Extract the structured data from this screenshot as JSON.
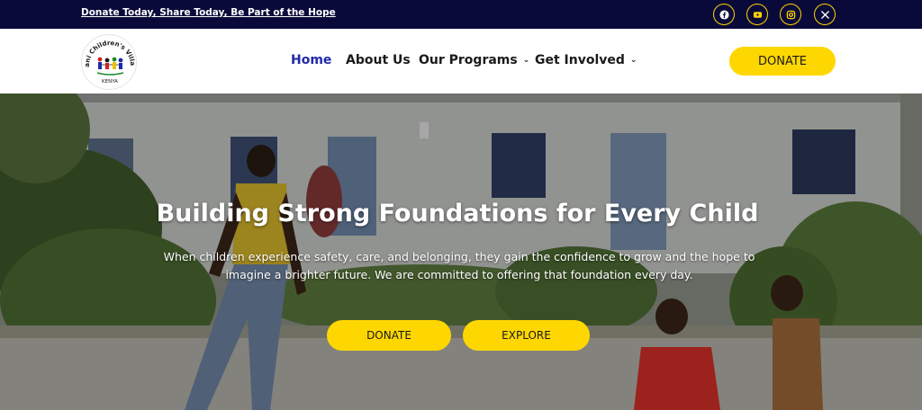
{
  "topbar": {
    "promo_text": "Donate Today, Share Today, Be Part of the Hope",
    "social": [
      {
        "icon": "facebook-icon"
      },
      {
        "icon": "youtube-icon"
      },
      {
        "icon": "instagram-icon"
      },
      {
        "icon": "x-icon"
      }
    ]
  },
  "logo": {
    "text_top": "Diani Children's Village",
    "text_bottom": "KENYA"
  },
  "nav": {
    "home": "Home",
    "about": "About Us",
    "programs": "Our Programs",
    "involved": "Get Involved",
    "caret": "⌄",
    "donate": "DONATE"
  },
  "hero": {
    "title": "Building Strong Foundations for Every Child",
    "subtitle": "When children experience safety, care, and belonging, they gain the confidence to grow and the hope to imagine a brighter future. We are committed to offering that foundation every day.",
    "donate_button": "DONATE",
    "explore_button": "EXPLORE"
  },
  "colors": {
    "topbar_bg": "#0a0a3a",
    "accent": "#ffd700",
    "nav_active": "#1f2aa8"
  }
}
